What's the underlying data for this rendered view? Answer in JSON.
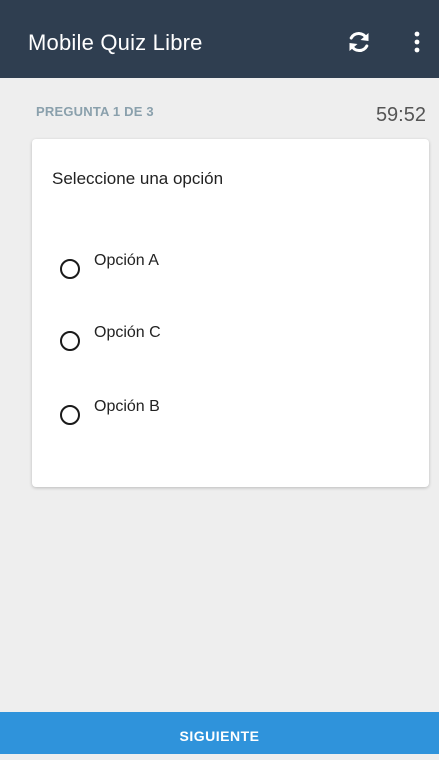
{
  "app_bar": {
    "title": "Mobile Quiz Libre",
    "background": "#2f3e50",
    "actions": [
      {
        "icon": "refresh-icon"
      },
      {
        "icon": "more-vert-icon"
      }
    ]
  },
  "quiz": {
    "counter": "PREGUNTA 1 DE 3",
    "timer": "59:52",
    "prompt": "Seleccione una opción",
    "options": [
      {
        "label": "Opción A",
        "selected": false
      },
      {
        "label": "Opción C",
        "selected": false
      },
      {
        "label": "Opción B",
        "selected": false
      }
    ]
  },
  "footer": {
    "next_label": "SIGUIENTE",
    "background": "#2f93db"
  }
}
